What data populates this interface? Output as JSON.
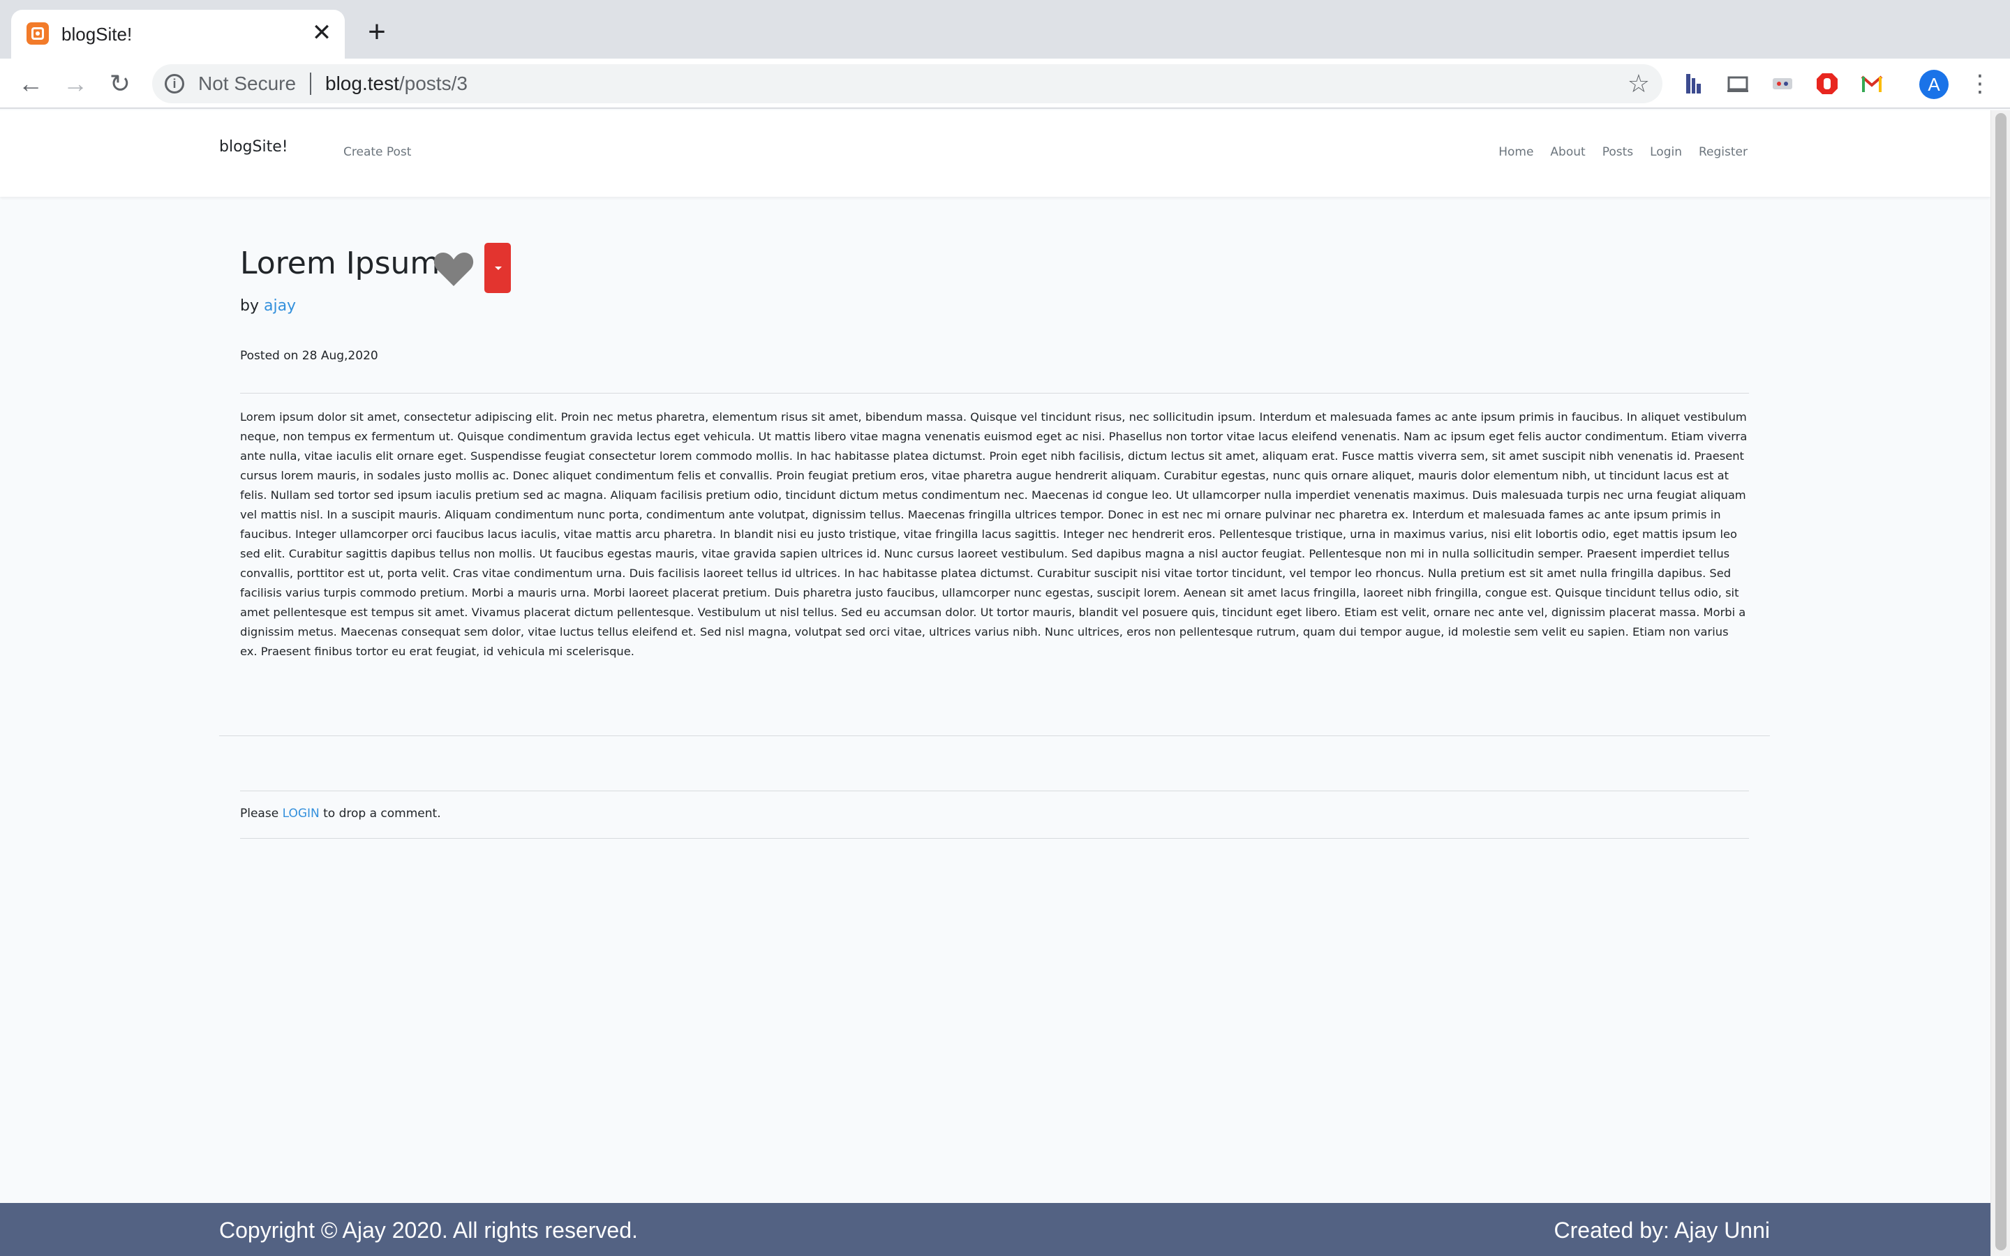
{
  "browser": {
    "tab_title": "blogSite!",
    "tab_close": "✕",
    "new_tab": "+",
    "back": "←",
    "forward": "→",
    "reload": "↻",
    "security_label": "Not Secure",
    "url_host": "blog.test",
    "url_path": "/posts/3",
    "star": "☆",
    "avatar_letter": "A",
    "menu": "⋮",
    "extension_icons": [
      "ruler-extension-icon",
      "cast-icon",
      "extension-icon",
      "adblock-icon",
      "gmail-icon"
    ]
  },
  "nav": {
    "brand": "blogSite!",
    "create_post": "Create Post",
    "links": [
      "Home",
      "About",
      "Posts",
      "Login",
      "Register"
    ]
  },
  "post": {
    "title": "Lorem Ipsum",
    "by_prefix": "by ",
    "author": "ajay",
    "posted": "Posted on 28 Aug,2020",
    "body": "Lorem ipsum dolor sit amet, consectetur adipiscing elit. Proin nec metus pharetra, elementum risus sit amet, bibendum massa. Quisque vel tincidunt risus, nec sollicitudin ipsum. Interdum et malesuada fames ac ante ipsum primis in faucibus. In aliquet vestibulum neque, non tempus ex fermentum ut. Quisque condimentum gravida lectus eget vehicula. Ut mattis libero vitae magna venenatis euismod eget ac nisi. Phasellus non tortor vitae lacus eleifend venenatis. Nam ac ipsum eget felis auctor condimentum. Etiam viverra ante nulla, vitae iaculis elit ornare eget. Suspendisse feugiat consectetur lorem commodo mollis. In hac habitasse platea dictumst. Proin eget nibh facilisis, dictum lectus sit amet, aliquam erat. Fusce mattis viverra sem, sit amet suscipit nibh venenatis id. Praesent cursus lorem mauris, in sodales justo mollis ac. Donec aliquet condimentum felis et convallis. Proin feugiat pretium eros, vitae pharetra augue hendrerit aliquam. Curabitur egestas, nunc quis ornare aliquet, mauris dolor elementum nibh, ut tincidunt lacus est at felis. Nullam sed tortor sed ipsum iaculis pretium sed ac magna. Aliquam facilisis pretium odio, tincidunt dictum metus condimentum nec. Maecenas id congue leo. Ut ullamcorper nulla imperdiet venenatis maximus. Duis malesuada turpis nec urna feugiat aliquam vel mattis nisl. In a suscipit mauris. Aliquam condimentum nunc porta, condimentum ante volutpat, dignissim tellus. Maecenas fringilla ultrices tempor. Donec in est nec mi ornare pulvinar nec pharetra ex. Interdum et malesuada fames ac ante ipsum primis in faucibus. Integer ullamcorper orci faucibus lacus iaculis, vitae mattis arcu pharetra. In blandit nisi eu justo tristique, vitae fringilla lacus sagittis. Integer nec hendrerit eros. Pellentesque tristique, urna in maximus varius, nisi elit lobortis odio, eget mattis ipsum leo sed elit. Curabitur sagittis dapibus tellus non mollis. Ut faucibus egestas mauris, vitae gravida sapien ultrices id. Nunc cursus laoreet vestibulum. Sed dapibus magna a nisl auctor feugiat. Pellentesque non mi in nulla sollicitudin semper. Praesent imperdiet tellus convallis, porttitor est ut, porta velit. Cras vitae condimentum urna. Duis facilisis laoreet tellus id ultrices. In hac habitasse platea dictumst. Curabitur suscipit nisi vitae tortor tincidunt, vel tempor leo rhoncus. Nulla pretium est sit amet nulla fringilla dapibus. Sed facilisis varius turpis commodo pretium. Morbi a mauris urna. Morbi laoreet placerat pretium. Duis pharetra justo faucibus, ullamcorper nunc egestas, suscipit lorem. Aenean sit amet lacus fringilla, laoreet nibh fringilla, congue est. Quisque tincidunt tellus odio, sit amet pellentesque est tempus sit amet. Vivamus placerat dictum pellentesque. Vestibulum ut nisl tellus. Sed eu accumsan dolor. Ut tortor mauris, blandit vel posuere quis, tincidunt eget libero. Etiam est velit, ornare nec ante vel, dignissim placerat massa. Morbi a dignissim metus. Maecenas consequat sem dolor, vitae luctus tellus eleifend et. Sed nisl magna, volutpat sed orci vitae, ultrices varius nibh. Nunc ultrices, eros non pellentesque rutrum, quam dui tempor augue, id molestie sem velit eu sapien. Etiam non varius ex. Praesent finibus tortor eu erat feugiat, id vehicula mi scelerisque.",
    "comment_prefix": "Please ",
    "comment_link": "LOGIN",
    "comment_suffix": " to drop a comment."
  },
  "footer": {
    "copyright": "Copyright © Ajay 2020. All rights reserved.",
    "created_by": "Created by: Ajay Unni"
  },
  "colors": {
    "accent_link": "#3490dc",
    "dropdown_red": "#e3342f",
    "footer_bg": "#536283"
  }
}
